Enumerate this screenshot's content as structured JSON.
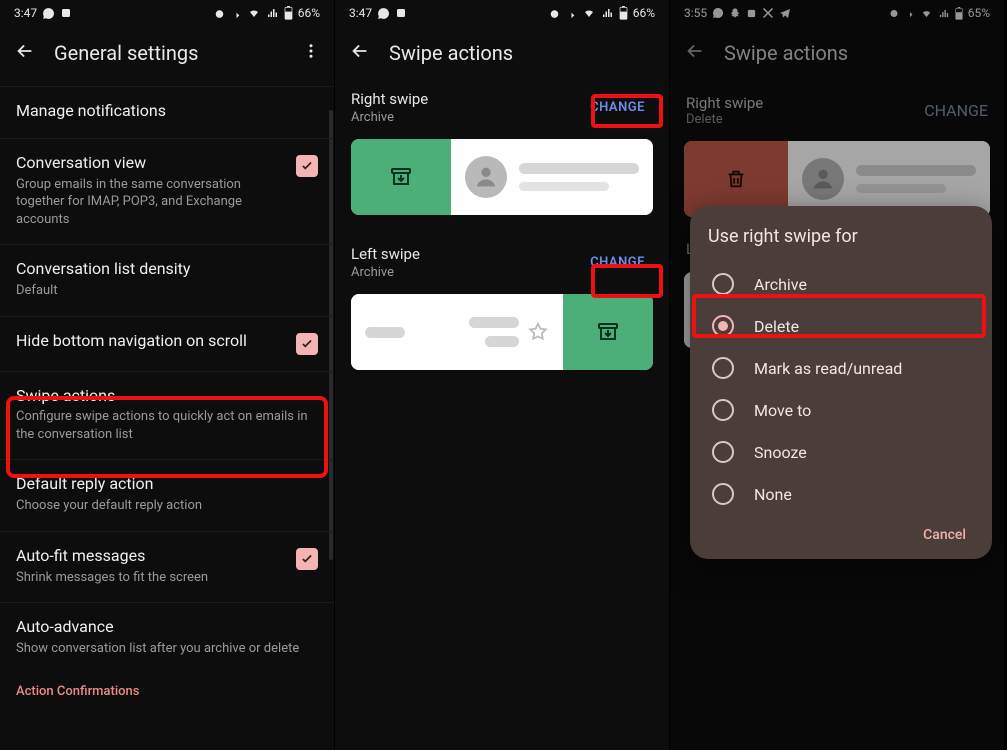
{
  "status_left_time_a": "3:47",
  "status_left_time_b": "3:55",
  "battery_a": "66%",
  "battery_b": "65%",
  "panel1": {
    "title": "General settings",
    "rows": {
      "manage": "Manage notifications",
      "conv_view_t": "Conversation view",
      "conv_view_s": "Group emails in the same conversation together for IMAP, POP3, and Exchange accounts",
      "density_t": "Conversation list density",
      "density_s": "Default",
      "hide_nav": "Hide bottom navigation on scroll",
      "swipe_t": "Swipe actions",
      "swipe_s": "Configure swipe actions to quickly act on emails in the conversation list",
      "reply_t": "Default reply action",
      "reply_s": "Choose your default reply action",
      "autofit_t": "Auto-fit messages",
      "autofit_s": "Shrink messages to fit the screen",
      "adv_t": "Auto-advance",
      "adv_s": "Show conversation list after you archive or delete",
      "action_conf": "Action Confirmations"
    }
  },
  "panel2": {
    "title": "Swipe actions",
    "right_label": "Right swipe",
    "right_value": "Archive",
    "left_label": "Left swipe",
    "left_value": "Archive",
    "change": "CHANGE"
  },
  "panel3": {
    "title": "Swipe actions",
    "right_label": "Right swipe",
    "right_value": "Delete",
    "left_label": "L",
    "change": "CHANGE",
    "dialog_title": "Use right swipe for",
    "opts": {
      "archive": "Archive",
      "delete": "Delete",
      "mark": "Mark as read/unread",
      "move": "Move to",
      "snooze": "Snooze",
      "none": "None"
    },
    "cancel": "Cancel"
  }
}
